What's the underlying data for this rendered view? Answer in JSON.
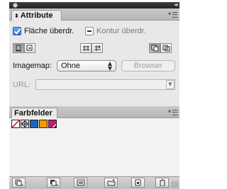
{
  "attribute_panel": {
    "tab_label": "Attribute",
    "fill_overprint_label": "Fläche überdr.",
    "stroke_overprint_label": "Kontur überdr.",
    "imagemap_label": "Imagemap:",
    "imagemap_value": "Ohne",
    "browser_button_label": "Browser",
    "url_label": "URL:"
  },
  "swatches_panel": {
    "tab_label": "Farbfelder",
    "swatches": [
      {
        "name": "none-swatch",
        "color": "#ffffff"
      },
      {
        "name": "registration-swatch",
        "color": "#ffffff"
      },
      {
        "name": "blue-swatch",
        "color": "#1f64b8"
      },
      {
        "name": "orange-swatch",
        "color": "#f29a00"
      },
      {
        "name": "magenta-swatch",
        "color": "#c8157a"
      }
    ]
  },
  "colors": {
    "checkbox_accent": "#2f75d9",
    "panel_bg": "#e8e8e8"
  }
}
